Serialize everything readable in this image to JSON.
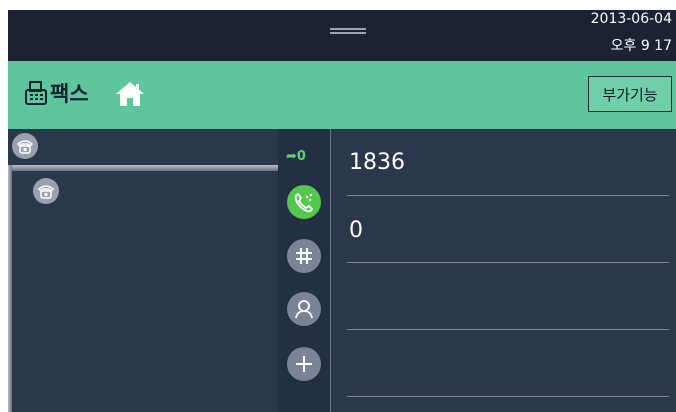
{
  "status_bar": {
    "date": "2013-06-04",
    "time": "오후 9 17"
  },
  "header": {
    "title": "팩스",
    "extra_button": "부가기능"
  },
  "toolbar": {
    "redial_count": "0",
    "buttons": [
      "call-icon",
      "hash-icon",
      "contact-icon",
      "add-icon"
    ]
  },
  "fields": {
    "fax_number": "1836",
    "pages": "0"
  },
  "colors": {
    "header": "#5fc59c",
    "panel": "#2b374b",
    "status_bar": "#1b2233",
    "call_button": "#54c84e"
  }
}
